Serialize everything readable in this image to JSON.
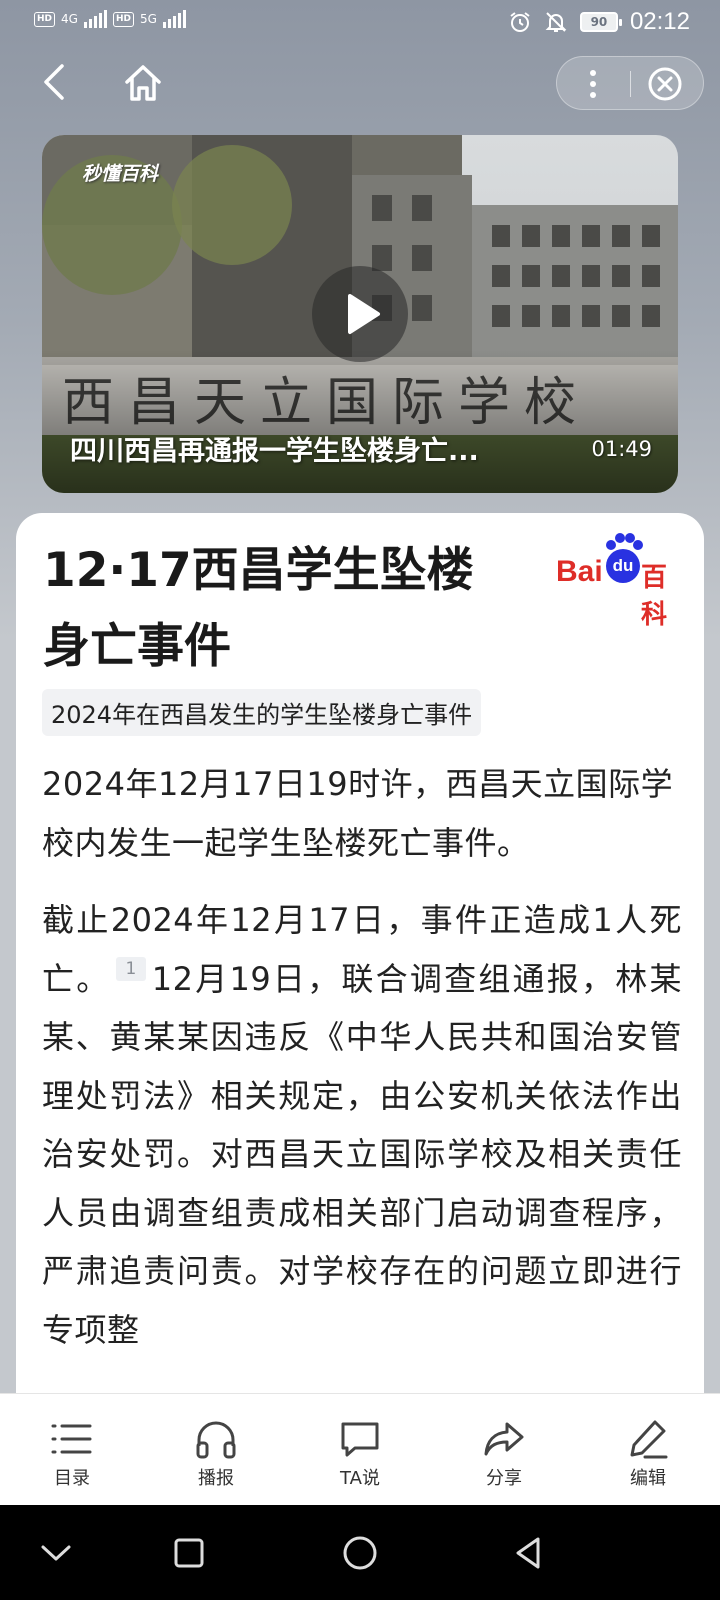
{
  "status_bar": {
    "network_1": "4G",
    "network_2": "5G",
    "hd": "HD",
    "battery": "90",
    "time": "02:12"
  },
  "video": {
    "watermark": "秒懂百科",
    "title": "四川西昌再通报一学生坠楼身亡...",
    "duration": "01:49"
  },
  "article": {
    "title": "12·17西昌学生坠楼身亡事件",
    "logo_brand": "百科",
    "logo_bai": "Bai",
    "logo_du": "du",
    "tagline": "2024年在西昌发生的学生坠楼身亡事件",
    "para1": "2024年12月17日19时许，西昌天立国际学校内发生一起学生坠楼死亡事件。",
    "para2_a": "截止2024年12月17日，事件正造成1人死亡。",
    "citation": "1",
    "para2_b": "12月19日，联合调查组通报，林某某、黄某某因违反《中华人民共和国治安管理处罚法》相关规定，由公安机关依法作出治安处罚。对西昌天立国际学校及相关责任人员由调查组责成相关部门启动调查程序，严肃追责问责。对学校存在的问题立即进行专项整"
  },
  "toolbar": {
    "items": [
      {
        "label": "目录",
        "icon": "list-icon"
      },
      {
        "label": "播报",
        "icon": "headphones-icon"
      },
      {
        "label": "TA说",
        "icon": "chat-bubble-icon"
      },
      {
        "label": "分享",
        "icon": "share-arrow-icon"
      },
      {
        "label": "编辑",
        "icon": "pencil-icon"
      }
    ]
  },
  "colors": {
    "baidu_red": "#de2d28",
    "baidu_blue": "#2932e1",
    "card_bg": "#ffffff"
  }
}
